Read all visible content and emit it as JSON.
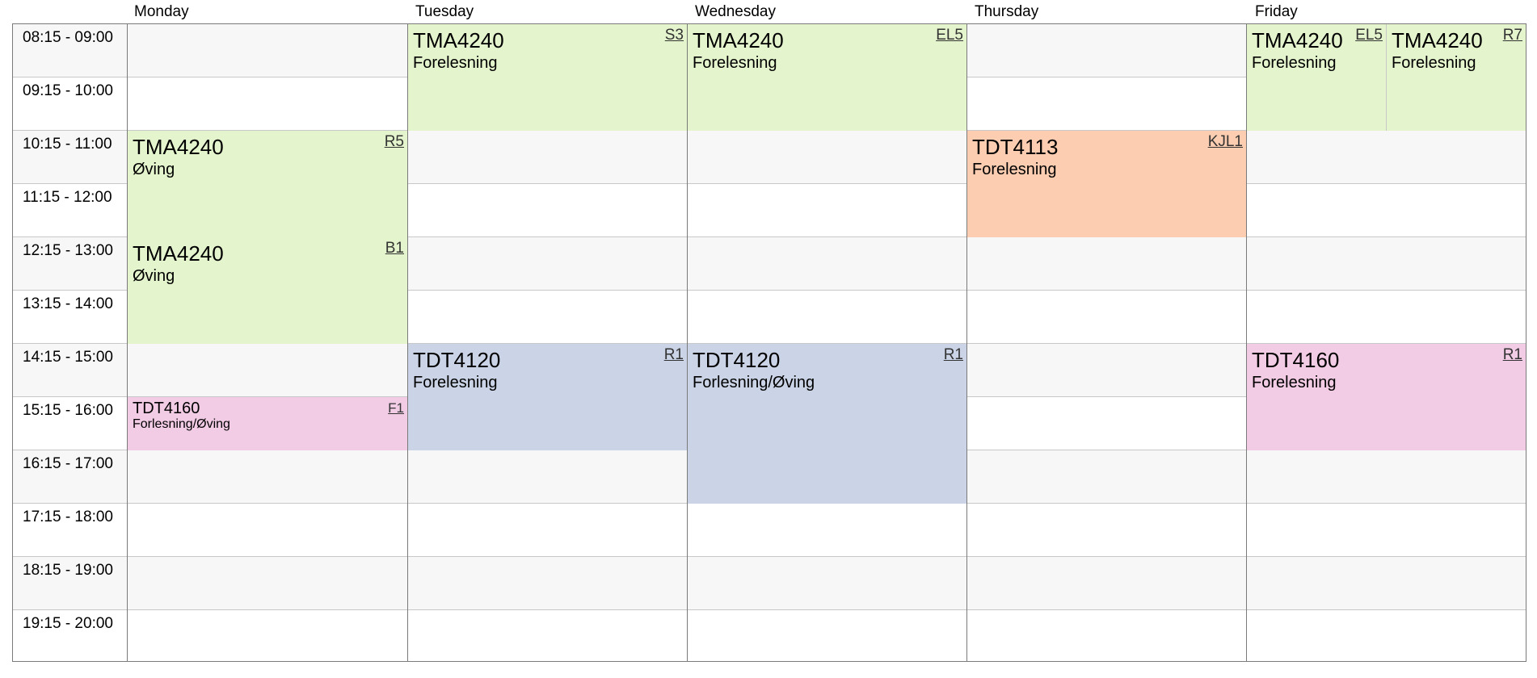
{
  "days": [
    "Monday",
    "Tuesday",
    "Wednesday",
    "Thursday",
    "Friday"
  ],
  "times": [
    "08:15 - 09:00",
    "09:15 - 10:00",
    "10:15 - 11:00",
    "11:15 - 12:00",
    "12:15 - 13:00",
    "13:15 - 14:00",
    "14:15 - 15:00",
    "15:15 - 16:00",
    "16:15 - 17:00",
    "17:15 - 18:00",
    "18:15 - 19:00",
    "19:15 - 20:00"
  ],
  "events": [
    {
      "day": "Monday",
      "start": "10:15",
      "end": "12:00",
      "course": "TMA4240",
      "type": "Øving",
      "room": "R5",
      "color": "#e4f4cc"
    },
    {
      "day": "Monday",
      "start": "12:15",
      "end": "14:00",
      "course": "TMA4240",
      "type": "Øving",
      "room": "B1",
      "color": "#e4f4cc"
    },
    {
      "day": "Monday",
      "start": "15:15",
      "end": "16:00",
      "course": "TDT4160",
      "type": "Forlesning/Øving",
      "room": "F1",
      "color": "#f2cbe4"
    },
    {
      "day": "Tuesday",
      "start": "08:15",
      "end": "10:00",
      "course": "TMA4240",
      "type": "Forelesning",
      "room": "S3",
      "color": "#e4f4cc"
    },
    {
      "day": "Tuesday",
      "start": "14:15",
      "end": "16:00",
      "course": "TDT4120",
      "type": "Forelesning",
      "room": "R1",
      "color": "#cbd4e6"
    },
    {
      "day": "Wednesday",
      "start": "08:15",
      "end": "10:00",
      "course": "TMA4240",
      "type": "Forelesning",
      "room": "EL5",
      "color": "#e4f4cc"
    },
    {
      "day": "Wednesday",
      "start": "14:15",
      "end": "17:00",
      "course": "TDT4120",
      "type": "Forlesning/Øving",
      "room": "R1",
      "color": "#cbd4e6"
    },
    {
      "day": "Thursday",
      "start": "10:15",
      "end": "12:00",
      "course": "TDT4113",
      "type": "Forelesning",
      "room": "KJL1",
      "color": "#fccdb0"
    },
    {
      "day": "Friday",
      "start": "08:15",
      "end": "10:00",
      "course": "TMA4240",
      "type": "Forelesning",
      "room": "EL5",
      "color": "#e4f4cc"
    },
    {
      "day": "Friday",
      "start": "08:15",
      "end": "10:00",
      "course": "TMA4240",
      "type": "Forelesning",
      "room": "R7",
      "color": "#e4f4cc"
    },
    {
      "day": "Friday",
      "start": "14:15",
      "end": "16:00",
      "course": "TDT4160",
      "type": "Forelesning",
      "room": "R1",
      "color": "#f2cbe4"
    }
  ]
}
